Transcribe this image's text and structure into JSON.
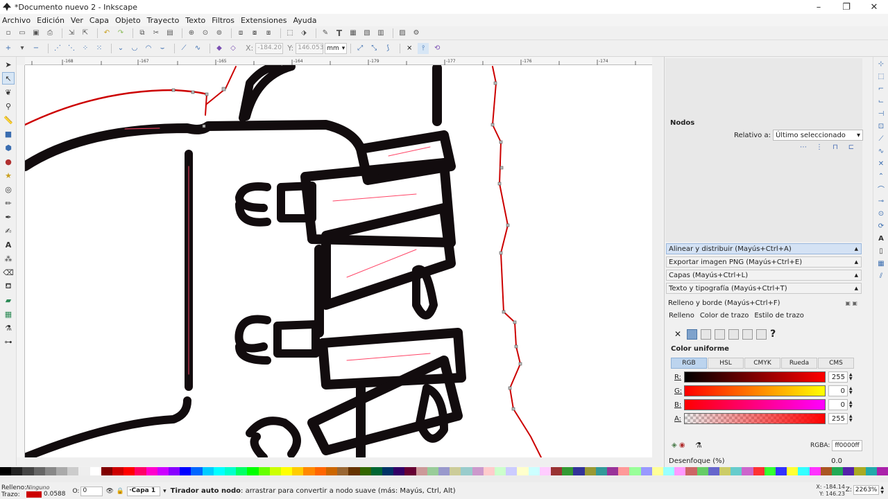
{
  "window": {
    "title": "*Documento nuevo 2 - Inkscape",
    "buttons": [
      "–",
      "❐",
      "✕"
    ]
  },
  "menu": [
    "Archivo",
    "Edición",
    "Ver",
    "Capa",
    "Objeto",
    "Trayecto",
    "Texto",
    "Filtros",
    "Extensiones",
    "Ayuda"
  ],
  "node_toolbar": {
    "x_label": "X:",
    "x_value": "-184.20",
    "y_label": "Y:",
    "y_value": "146.053",
    "unit": "mm"
  },
  "ruler_labels": [
    "-168",
    "-167",
    "-165",
    "-164",
    "-179",
    "-177",
    "-176",
    "-174"
  ],
  "nodes_panel": {
    "title": "Nodos",
    "relative_label": "Relativo a:",
    "relative_value": "Último seleccionado"
  },
  "docks": [
    {
      "label": "Alinear y distribuir (Mayús+Ctrl+A)",
      "selected": true
    },
    {
      "label": "Exportar imagen PNG (Mayús+Ctrl+E)",
      "selected": false
    },
    {
      "label": "Capas (Mayús+Ctrl+L)",
      "selected": false
    },
    {
      "label": "Texto y tipografía (Mayús+Ctrl+T)",
      "selected": false
    }
  ],
  "fill_stroke": {
    "title": "Relleno y borde (Mayús+Ctrl+F)",
    "tabs": [
      "Relleno",
      "Color de trazo",
      "Estilo de trazo"
    ],
    "flat_label": "Color uniforme",
    "modes": [
      "RGB",
      "HSL",
      "CMYK",
      "Rueda",
      "CMS"
    ],
    "channels": [
      {
        "label": "R:",
        "value": "255"
      },
      {
        "label": "G:",
        "value": "0"
      },
      {
        "label": "B:",
        "value": "0"
      },
      {
        "label": "A:",
        "value": "255"
      }
    ],
    "rgba_label": "RGBA:",
    "rgba_value": "ff0000ff",
    "blur_label": "Desenfoque (%)",
    "blur_value": "0.0"
  },
  "status": {
    "fill_label": "Relleno:",
    "stroke_label": "Trazo:",
    "fill_value": "Ninguno",
    "stroke_width": "0.0588",
    "opacity_label": "O:",
    "opacity_value": "0",
    "layer": "·Capa 1",
    "message_bold": "Tirador auto nodo",
    "message_rest": ": arrastrar para convertir a nodo suave (más: Mayús, Ctrl, Alt)",
    "cursor_x": "X: -184.14",
    "cursor_y": "Y: 146.23",
    "zoom_label": "Z:",
    "zoom_value": "2263%"
  },
  "colors": {
    "stroke_red": "#cc0000",
    "ink": "#120c0e",
    "selection": "#d4e2f4"
  }
}
